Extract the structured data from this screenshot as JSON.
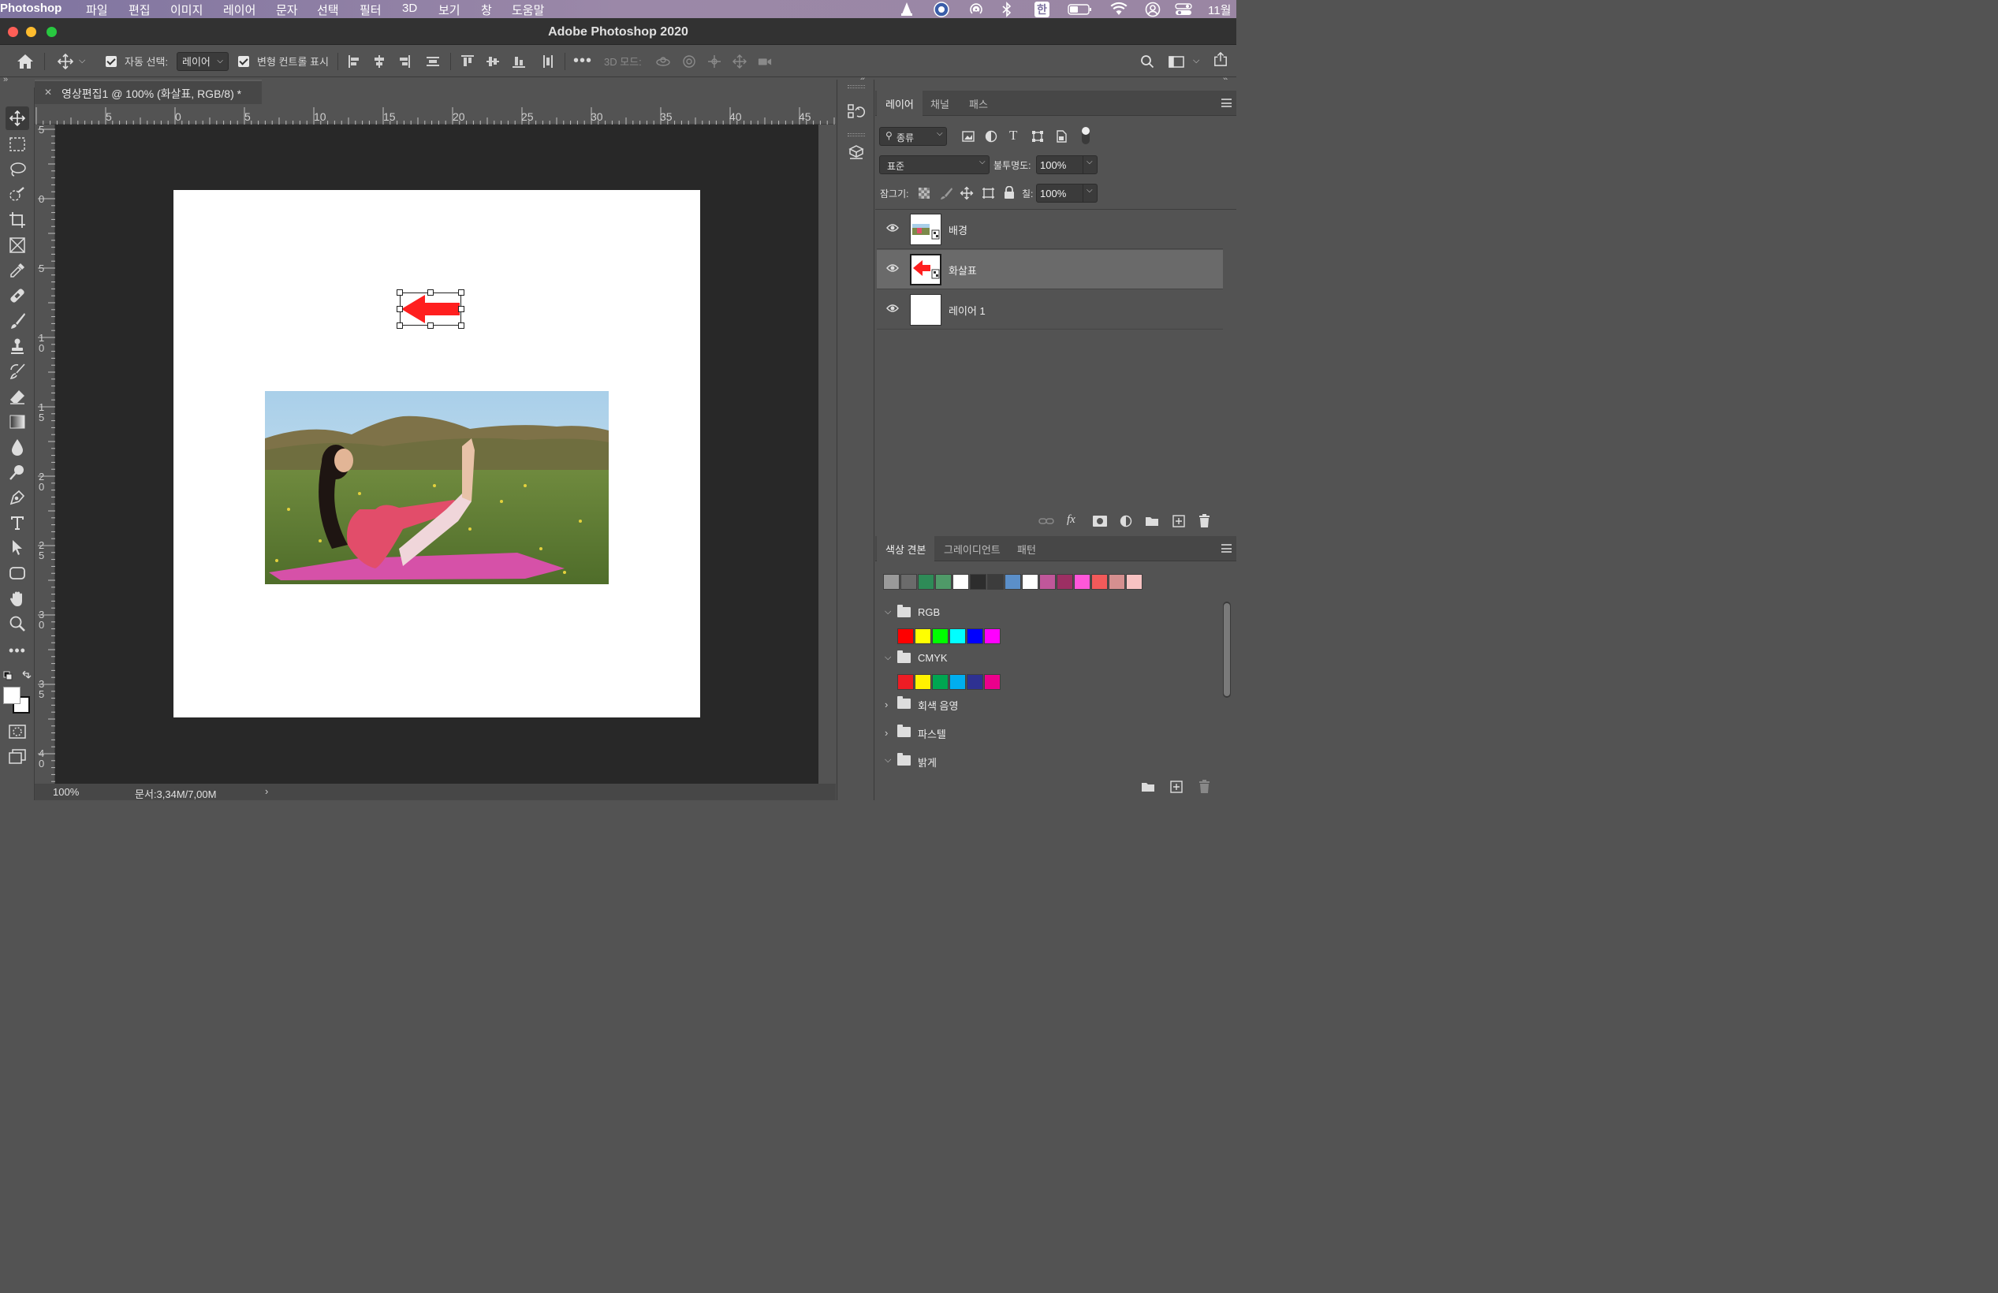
{
  "menubar": {
    "app": "Photoshop",
    "items": [
      "파일",
      "편집",
      "이미지",
      "레이어",
      "문자",
      "선택",
      "필터",
      "3D",
      "보기",
      "창",
      "도움말"
    ],
    "input_source": "한",
    "clock": "11월"
  },
  "window": {
    "title": "Adobe Photoshop 2020"
  },
  "options": {
    "auto_select_label": "자동 선택:",
    "auto_select_value": "레이어",
    "show_transform_label": "변형 컨트롤 표시",
    "mode_3d_label": "3D 모드:"
  },
  "document": {
    "tab_title": "영상편집1 @ 100% (화살표, RGB/8) *",
    "ruler_h": [
      "5",
      "0",
      "5",
      "10",
      "15",
      "20",
      "25",
      "30",
      "35",
      "40",
      "45"
    ],
    "ruler_v": [
      [
        "5"
      ],
      [
        "0"
      ],
      [
        "5"
      ],
      [
        "1",
        "0"
      ],
      [
        "1",
        "5"
      ],
      [
        "2",
        "0"
      ],
      [
        "2",
        "5"
      ],
      [
        "3",
        "0"
      ],
      [
        "3",
        "5"
      ],
      [
        "4",
        "0"
      ]
    ],
    "zoom": "100%",
    "doc_size": "문서:3,34M/7,00M"
  },
  "layers_panel": {
    "tabs": [
      "레이어",
      "채널",
      "패스"
    ],
    "filter_kind": "종류",
    "blend_mode": "표준",
    "opacity_label": "불투명도:",
    "opacity_value": "100%",
    "lock_label": "잠그기:",
    "fill_label": "칠:",
    "fill_value": "100%",
    "layers": [
      {
        "name": "배경",
        "visible": true,
        "selected": false
      },
      {
        "name": "화살표",
        "visible": true,
        "selected": true
      },
      {
        "name": "레이어 1",
        "visible": true,
        "selected": false
      }
    ]
  },
  "swatches_panel": {
    "tabs": [
      "색상 견본",
      "그레이디언트",
      "패턴"
    ],
    "recent": [
      "#9a9a9a",
      "#6b6b6b",
      "#2e8b57",
      "#4f9a68",
      "#ffffff",
      "#2d2d2d",
      "#3c3c3c",
      "#5b8fc9",
      "#ffffff",
      "#c0579a",
      "#9c2f63",
      "#ff57d9",
      "#f25a5a",
      "#d58f8f",
      "#f7c2c2"
    ],
    "groups": [
      {
        "name": "RGB",
        "expanded": true,
        "colors": [
          "#ff0000",
          "#ffff00",
          "#00ff00",
          "#00ffff",
          "#0000ff",
          "#ff00ff"
        ]
      },
      {
        "name": "CMYK",
        "expanded": true,
        "colors": [
          "#ed1c24",
          "#fff200",
          "#00a651",
          "#00aeef",
          "#2e3192",
          "#ec008c"
        ]
      },
      {
        "name": "회색 음영",
        "expanded": false,
        "colors": []
      },
      {
        "name": "파스텔",
        "expanded": false,
        "colors": []
      },
      {
        "name": "밝게",
        "expanded": true,
        "colors": []
      }
    ]
  },
  "colors": {
    "accent_red": "#ff1f1f",
    "canvas_bg": "#282828",
    "panel_bg": "#535353"
  }
}
